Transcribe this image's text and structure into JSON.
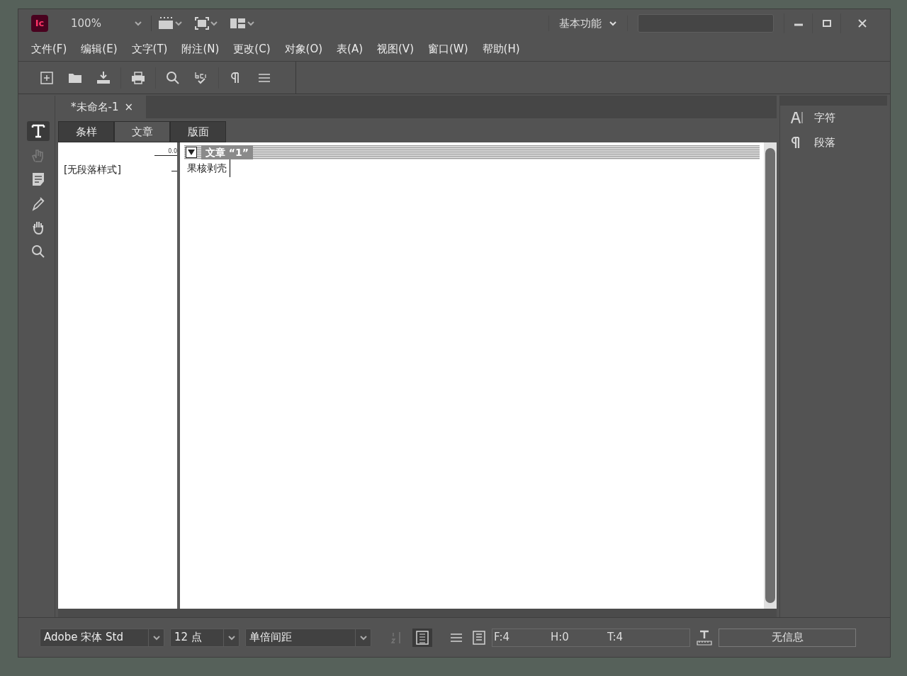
{
  "app": {
    "logo": "Ic",
    "zoom": "100%",
    "workspace": "基本功能"
  },
  "menu": [
    "文件(F)",
    "编辑(E)",
    "文字(T)",
    "附注(N)",
    "更改(C)",
    "对象(O)",
    "表(A)",
    "视图(V)",
    "窗口(W)",
    "帮助(H)"
  ],
  "document_tab": {
    "title": "*未命名-1",
    "close": "×"
  },
  "view_tabs": [
    {
      "label": "条样",
      "selected": false
    },
    {
      "label": "文章",
      "selected": true
    },
    {
      "label": "版面",
      "selected": false
    }
  ],
  "tools": [
    {
      "kind": "type",
      "selected": true,
      "disabled": false
    },
    {
      "kind": "position",
      "selected": false,
      "disabled": true
    },
    {
      "kind": "note",
      "selected": false,
      "disabled": false
    },
    {
      "kind": "eyedropper",
      "selected": false,
      "disabled": false
    },
    {
      "kind": "hand",
      "selected": false,
      "disabled": false
    },
    {
      "kind": "zoom",
      "selected": false,
      "disabled": false
    }
  ],
  "galley": {
    "ruler_reading": "0.0",
    "style_name": "[无段落样式]",
    "story_title": "文章 “1”",
    "story_text": "果核剥壳"
  },
  "panels": [
    {
      "kind": "character",
      "label": "字符"
    },
    {
      "kind": "paragraph",
      "label": "段落"
    }
  ],
  "status_bar": {
    "font": "Adobe 宋体 Std",
    "size": "12 点",
    "leading": "单倍间距",
    "counts": [
      "F:4",
      "H:0",
      "T:4"
    ],
    "info": "无信息"
  }
}
